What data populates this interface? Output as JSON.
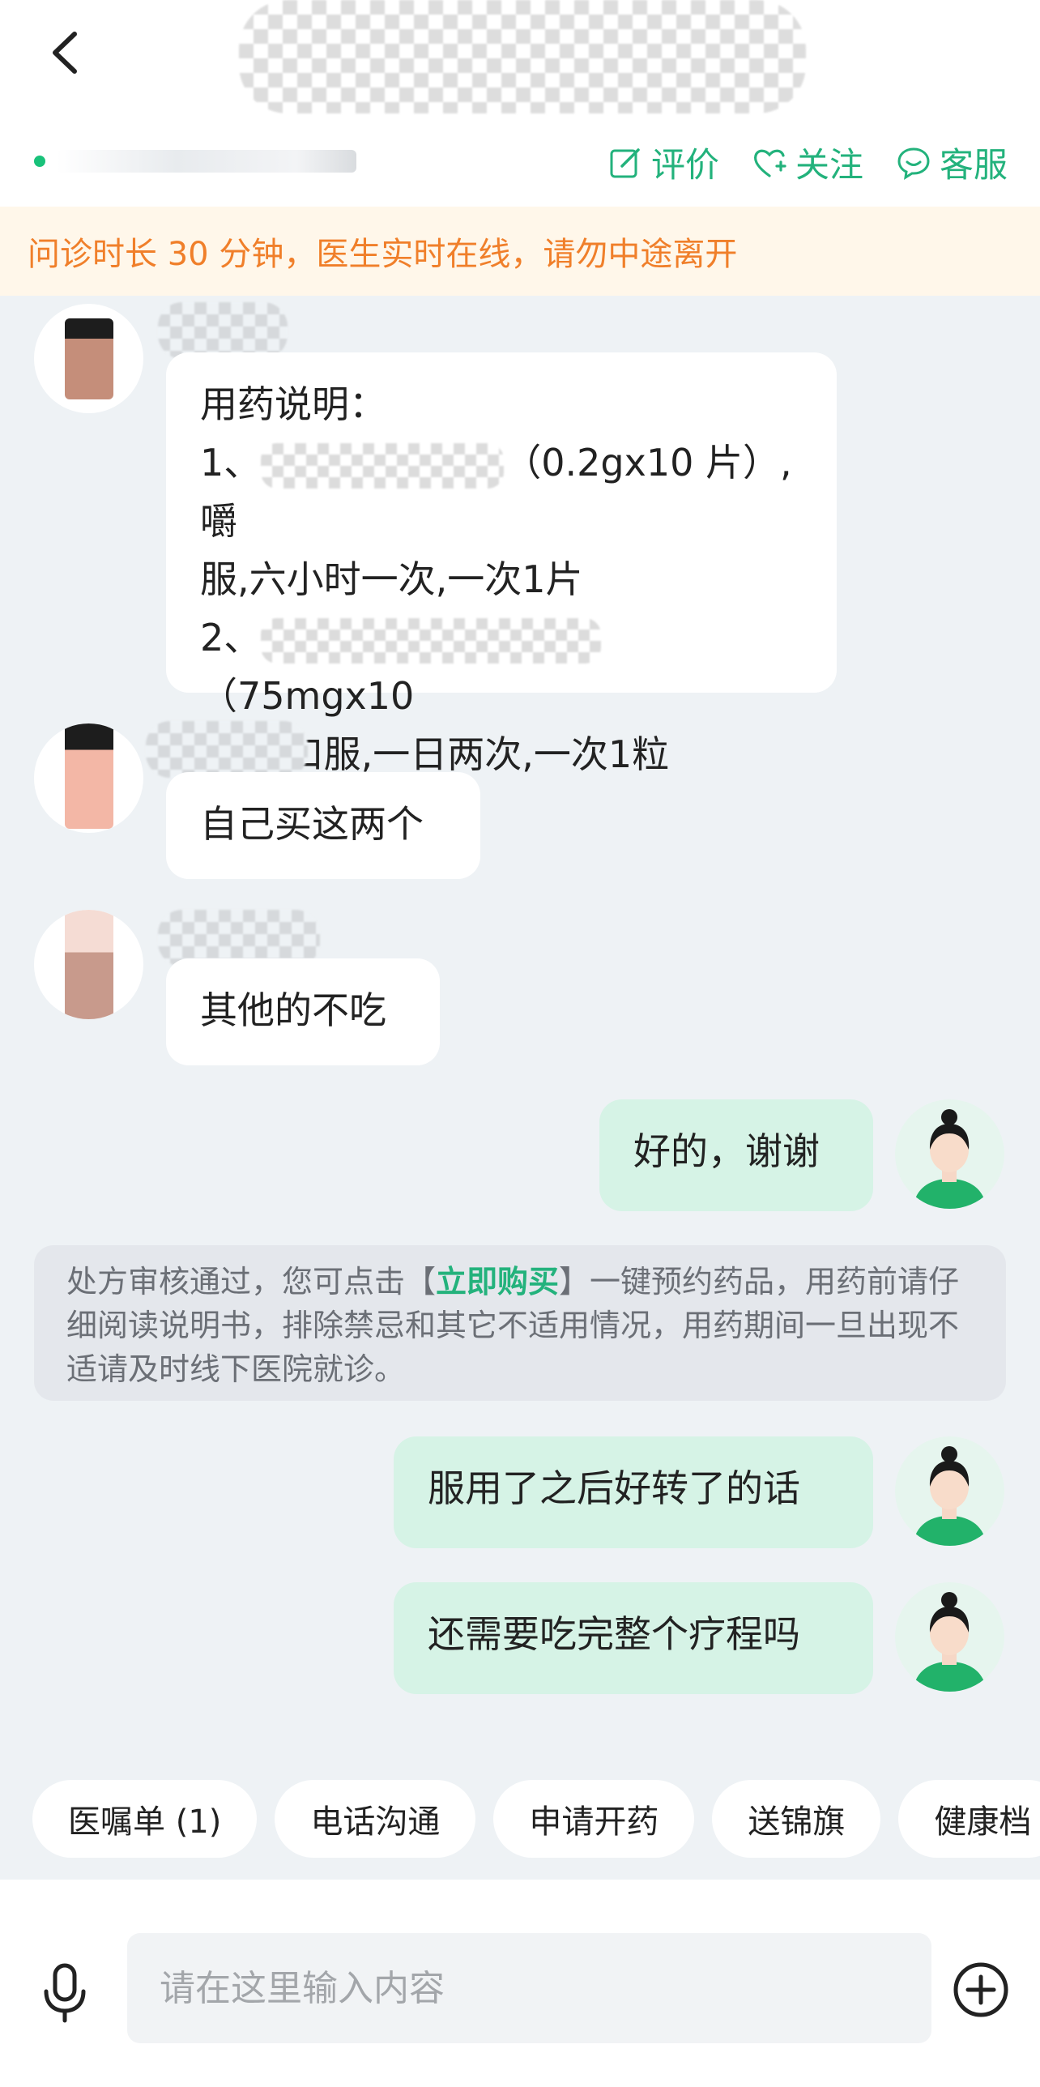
{
  "header": {
    "actions": [
      {
        "label": "评价",
        "icon": "edit-icon"
      },
      {
        "label": "关注",
        "icon": "heart-plus-icon"
      },
      {
        "label": "客服",
        "icon": "chat-smile-icon"
      }
    ]
  },
  "notice": {
    "text": "问诊时长 30 分钟，医生实时在线，请勿中途离开"
  },
  "messages": {
    "m1": {
      "line1": "用药说明：",
      "line2_prefix": "1、",
      "line2_suffix": "（0.2gx10 片）,嚼",
      "line3": "服,六小时一次,一次1片",
      "line4_prefix": "2、",
      "line4_suffix": "（75mgx10",
      "line5": "粒）,口服,一日两次,一次1粒"
    },
    "m2": {
      "text": "自己买这两个"
    },
    "m3": {
      "text": "其他的不吃"
    },
    "m4": {
      "text": "好的，谢谢"
    },
    "m5": {
      "text": "服用了之后好转了的话"
    },
    "m6": {
      "text": "还需要吃完整个疗程吗"
    }
  },
  "system_notice": {
    "before": "处方审核通过，您可点击【",
    "link": "立即购买",
    "after": "】一键预约药品，用药前请仔细阅读说明书，排除禁忌和其它不适用情况，用药期间一旦出现不适请及时线下医院就诊。"
  },
  "quick_actions": [
    "医嘱单 (1)",
    "电话沟通",
    "申请开药",
    "送锦旗",
    "健康档"
  ],
  "input": {
    "placeholder": "请在这里输入内容"
  },
  "colors": {
    "accent": "#23b27c",
    "notice_text": "#f07f2a",
    "my_bubble": "#d6f3e6"
  }
}
